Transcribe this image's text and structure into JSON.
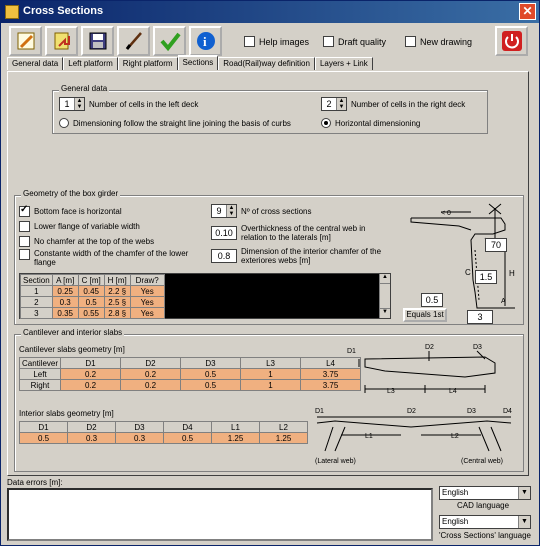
{
  "window": {
    "title": "Cross Sections",
    "close_glyph": "✕"
  },
  "toolbar": {
    "icons": [
      "pencil-icon",
      "document-arrow-icon",
      "floppy-icon",
      "pen-icon",
      "checkmark-icon",
      "info-icon",
      "power-icon"
    ],
    "help_images": "Help images",
    "draft_quality": "Draft quality",
    "new_drawing": "New drawing"
  },
  "tabs": [
    "General data",
    "Left platform",
    "Right platform",
    "Sections",
    "Road(Rail)way definition",
    "Layers + Link"
  ],
  "active_tab": "Sections",
  "general": {
    "legend": "General data",
    "left_cells": "1",
    "left_cells_label": "Number of cells in the left deck",
    "right_cells": "2",
    "right_cells_label": "Number of cells in the right deck",
    "dim_straight": "Dimensioning follow the straight line joining the basis of curbs",
    "dim_horizontal": "Horizontal dimensioning"
  },
  "girder": {
    "legend": "Geometry of the box girder",
    "bottom_horizontal": "Bottom face is horizontal",
    "lower_flange": "Lower flange of variable width",
    "no_chamfer": "No chamfer at the top of the webs",
    "constant_width": "Constante width of the chamfer of the lower flange",
    "n_sections": "9",
    "n_sections_label": "Nº of cross sections",
    "overthick": "0.10",
    "overthick_label": "Overthickness of the central web in relation to the laterals [m]",
    "chamfer_dim": "0.8",
    "chamfer_dim_label": "Dimension of the interior chamfer of the exteriores webs [m]",
    "table_headers": [
      "Section",
      "A [m]",
      "C [m]",
      "H [m]",
      "Draw?"
    ],
    "table_rows": [
      [
        "1",
        "0.25",
        "0.45",
        "2.2 §",
        "Yes"
      ],
      [
        "2",
        "0.3",
        "0.5",
        "2.5 §",
        "Yes"
      ],
      [
        "3",
        "0.35",
        "0.55",
        "2.8 §",
        "Yes"
      ]
    ],
    "diag_lt0": "< 0",
    "diag_70": "70",
    "diag_15": "1.5",
    "diag_05": "0.5",
    "diag_3": "3",
    "diag_C": "C",
    "diag_H": "H",
    "diag_A": "A",
    "equals_button": "Equals 1st"
  },
  "cantilever": {
    "legend": "Cantilever and interior slabs",
    "title": "Cantilever slabs geometry [m]",
    "headers": [
      "Cantilever",
      "D1",
      "D2",
      "D3",
      "L3",
      "L4"
    ],
    "rows": [
      [
        "Left",
        "0.2",
        "0.2",
        "0.5",
        "1",
        "3.75"
      ],
      [
        "Right",
        "0.2",
        "0.2",
        "0.5",
        "1",
        "3.75"
      ]
    ],
    "interior_title": "Interior slabs geometry [m]",
    "interior_headers": [
      "D1",
      "D2",
      "D3",
      "D4",
      "L1",
      "L2"
    ],
    "interior_row": [
      "0.5",
      "0.3",
      "0.3",
      "0.5",
      "1.25",
      "1.25"
    ],
    "diag_D1": "D1",
    "diag_D2": "D2",
    "diag_D3": "D3",
    "diag_D4": "D4",
    "diag_L1": "L1",
    "diag_L2": "L2",
    "diag_L3": "L3",
    "diag_L4": "L4",
    "lateral_web": "(Lateral web)",
    "central_web": "(Central web)"
  },
  "footer": {
    "errors_label": "Data errors [m]:",
    "cad_lang": "English",
    "cad_lang_label": "CAD language",
    "cs_lang": "English",
    "cs_lang_label": "'Cross Sections' language"
  }
}
